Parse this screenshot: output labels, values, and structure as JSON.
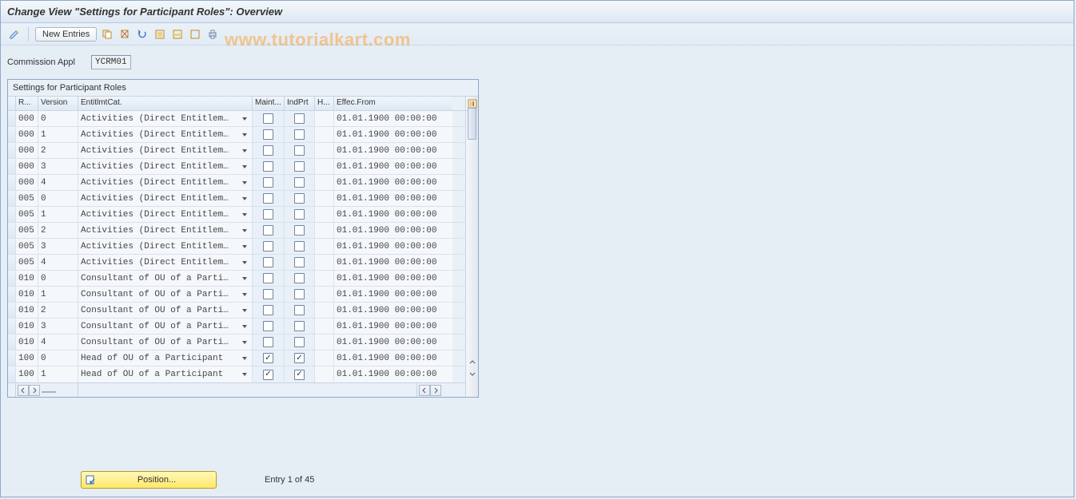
{
  "title": "Change View \"Settings for Participant Roles\": Overview",
  "toolbar": {
    "new_entries_label": "New Entries"
  },
  "watermark": "www.tutorialkart.com",
  "selection": {
    "commission_appl_label": "Commission Appl",
    "commission_appl_value": "YCRM01"
  },
  "table": {
    "title": "Settings for Participant Roles",
    "headers": {
      "r": "R...",
      "version": "Version",
      "entitlmt": "EntitlmtCat.",
      "maint": "Maint...",
      "indprt": "IndPrt",
      "h": "H...",
      "effec": "Effec.From"
    },
    "rows": [
      {
        "r": "000",
        "ver": "0",
        "ent": "Activities (Direct Entitlem…",
        "m": false,
        "ip": false,
        "h": "",
        "ef": "01.01.1900 00:00:00"
      },
      {
        "r": "000",
        "ver": "1",
        "ent": "Activities (Direct Entitlem…",
        "m": false,
        "ip": false,
        "h": "",
        "ef": "01.01.1900 00:00:00"
      },
      {
        "r": "000",
        "ver": "2",
        "ent": "Activities (Direct Entitlem…",
        "m": false,
        "ip": false,
        "h": "",
        "ef": "01.01.1900 00:00:00"
      },
      {
        "r": "000",
        "ver": "3",
        "ent": "Activities (Direct Entitlem…",
        "m": false,
        "ip": false,
        "h": "",
        "ef": "01.01.1900 00:00:00"
      },
      {
        "r": "000",
        "ver": "4",
        "ent": "Activities (Direct Entitlem…",
        "m": false,
        "ip": false,
        "h": "",
        "ef": "01.01.1900 00:00:00"
      },
      {
        "r": "005",
        "ver": "0",
        "ent": "Activities (Direct Entitlem…",
        "m": false,
        "ip": false,
        "h": "",
        "ef": "01.01.1900 00:00:00"
      },
      {
        "r": "005",
        "ver": "1",
        "ent": "Activities (Direct Entitlem…",
        "m": false,
        "ip": false,
        "h": "",
        "ef": "01.01.1900 00:00:00"
      },
      {
        "r": "005",
        "ver": "2",
        "ent": "Activities (Direct Entitlem…",
        "m": false,
        "ip": false,
        "h": "",
        "ef": "01.01.1900 00:00:00"
      },
      {
        "r": "005",
        "ver": "3",
        "ent": "Activities (Direct Entitlem…",
        "m": false,
        "ip": false,
        "h": "",
        "ef": "01.01.1900 00:00:00"
      },
      {
        "r": "005",
        "ver": "4",
        "ent": "Activities (Direct Entitlem…",
        "m": false,
        "ip": false,
        "h": "",
        "ef": "01.01.1900 00:00:00"
      },
      {
        "r": "010",
        "ver": "0",
        "ent": "Consultant of OU of a Parti…",
        "m": false,
        "ip": false,
        "h": "",
        "ef": "01.01.1900 00:00:00"
      },
      {
        "r": "010",
        "ver": "1",
        "ent": "Consultant of OU of a Parti…",
        "m": false,
        "ip": false,
        "h": "",
        "ef": "01.01.1900 00:00:00"
      },
      {
        "r": "010",
        "ver": "2",
        "ent": "Consultant of OU of a Parti…",
        "m": false,
        "ip": false,
        "h": "",
        "ef": "01.01.1900 00:00:00"
      },
      {
        "r": "010",
        "ver": "3",
        "ent": "Consultant of OU of a Parti…",
        "m": false,
        "ip": false,
        "h": "",
        "ef": "01.01.1900 00:00:00"
      },
      {
        "r": "010",
        "ver": "4",
        "ent": "Consultant of OU of a Parti…",
        "m": false,
        "ip": false,
        "h": "",
        "ef": "01.01.1900 00:00:00"
      },
      {
        "r": "100",
        "ver": "0",
        "ent": "Head of OU of a Participant",
        "m": true,
        "ip": true,
        "h": "",
        "ef": "01.01.1900 00:00:00"
      },
      {
        "r": "100",
        "ver": "1",
        "ent": "Head of OU of a Participant",
        "m": true,
        "ip": true,
        "h": "",
        "ef": "01.01.1900 00:00:00"
      }
    ]
  },
  "footer": {
    "position_label": "Position...",
    "entry_status": "Entry 1 of 45"
  }
}
